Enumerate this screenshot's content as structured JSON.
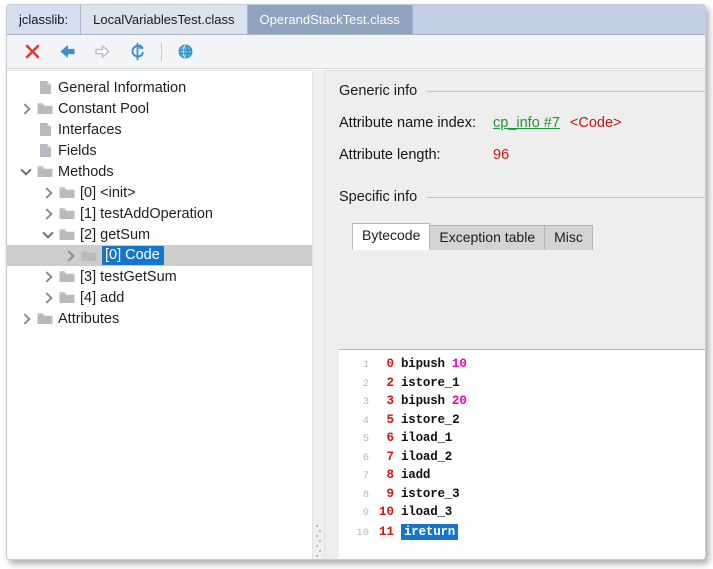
{
  "window": {
    "tabs": [
      {
        "label": "jclasslib:",
        "state": "brand",
        "name": "tab-brand"
      },
      {
        "label": "LocalVariablesTest.class",
        "state": "inactive",
        "name": "tab-localvariablestest"
      },
      {
        "label": "OperandStackTest.class",
        "state": "active",
        "name": "tab-operandstacktest"
      }
    ]
  },
  "toolbar": {
    "buttons": [
      {
        "icon": "close-icon",
        "name": "close-button"
      },
      {
        "icon": "back-arrow-icon",
        "name": "back-button"
      },
      {
        "icon": "forward-arrow-icon",
        "name": "forward-button"
      },
      {
        "icon": "reload-icon",
        "name": "reload-button"
      },
      {
        "icon": "globe-icon",
        "name": "browse-button"
      }
    ]
  },
  "tree": {
    "items": [
      {
        "label": "General Information",
        "indent": 0,
        "twisty": "none",
        "icon": "page-icon",
        "selected": false,
        "highlighted": false
      },
      {
        "label": "Constant Pool",
        "indent": 0,
        "twisty": "right",
        "icon": "folder-icon",
        "selected": false,
        "highlighted": false
      },
      {
        "label": "Interfaces",
        "indent": 0,
        "twisty": "none",
        "icon": "page-icon",
        "selected": false,
        "highlighted": false
      },
      {
        "label": "Fields",
        "indent": 0,
        "twisty": "none",
        "icon": "page-icon",
        "selected": false,
        "highlighted": false
      },
      {
        "label": "Methods",
        "indent": 0,
        "twisty": "down",
        "icon": "folder-icon",
        "selected": false,
        "highlighted": false
      },
      {
        "label": "[0] <init>",
        "indent": 1,
        "twisty": "right",
        "icon": "folder-icon",
        "selected": false,
        "highlighted": false
      },
      {
        "label": "[1] testAddOperation",
        "indent": 1,
        "twisty": "right",
        "icon": "folder-icon",
        "selected": false,
        "highlighted": false
      },
      {
        "label": "[2] getSum",
        "indent": 1,
        "twisty": "down",
        "icon": "folder-icon",
        "selected": false,
        "highlighted": false
      },
      {
        "label": "[0] Code",
        "indent": 2,
        "twisty": "right",
        "icon": "folder-icon",
        "selected": true,
        "highlighted": true
      },
      {
        "label": "[3] testGetSum",
        "indent": 1,
        "twisty": "right",
        "icon": "folder-icon",
        "selected": false,
        "highlighted": false
      },
      {
        "label": "[4] add",
        "indent": 1,
        "twisty": "right",
        "icon": "folder-icon",
        "selected": false,
        "highlighted": false
      },
      {
        "label": "Attributes",
        "indent": 0,
        "twisty": "right",
        "icon": "folder-icon",
        "selected": false,
        "highlighted": false
      }
    ]
  },
  "detail": {
    "generic_header": "Generic info",
    "specific_header": "Specific info",
    "attribute_name_index_label": "Attribute name index:",
    "attribute_name_index_link": "cp_info #7",
    "attribute_name_index_value": "<Code>",
    "attribute_length_label": "Attribute length:",
    "attribute_length_value": "96",
    "inner_tabs": [
      {
        "label": "Bytecode",
        "active": true
      },
      {
        "label": "Exception table",
        "active": false
      },
      {
        "label": "Misc",
        "active": false
      }
    ]
  },
  "bytecode": {
    "lines": [
      {
        "num": "1",
        "offset": "0",
        "mnemonic": "bipush",
        "operand": "10",
        "selected": false
      },
      {
        "num": "2",
        "offset": "2",
        "mnemonic": "istore_1",
        "operand": "",
        "selected": false
      },
      {
        "num": "3",
        "offset": "3",
        "mnemonic": "bipush",
        "operand": "20",
        "selected": false
      },
      {
        "num": "4",
        "offset": "5",
        "mnemonic": "istore_2",
        "operand": "",
        "selected": false
      },
      {
        "num": "5",
        "offset": "6",
        "mnemonic": "iload_1",
        "operand": "",
        "selected": false
      },
      {
        "num": "6",
        "offset": "7",
        "mnemonic": "iload_2",
        "operand": "",
        "selected": false
      },
      {
        "num": "7",
        "offset": "8",
        "mnemonic": "iadd",
        "operand": "",
        "selected": false
      },
      {
        "num": "8",
        "offset": "9",
        "mnemonic": "istore_3",
        "operand": "",
        "selected": false
      },
      {
        "num": "9",
        "offset": "10",
        "mnemonic": "iload_3",
        "operand": "",
        "selected": false
      },
      {
        "num": "10",
        "offset": "11",
        "mnemonic": "ireturn",
        "operand": "",
        "selected": true
      }
    ]
  },
  "colors": {
    "tab_active_bg": "#8fa3bf",
    "tab_bar_bg": "#c3d0e4",
    "selection_blue": "#1676c9",
    "link_green": "#1a9a33",
    "value_red": "#cc1111",
    "operand_magenta": "#ee00bb",
    "tree_row_selected": "#cdcdcd"
  }
}
